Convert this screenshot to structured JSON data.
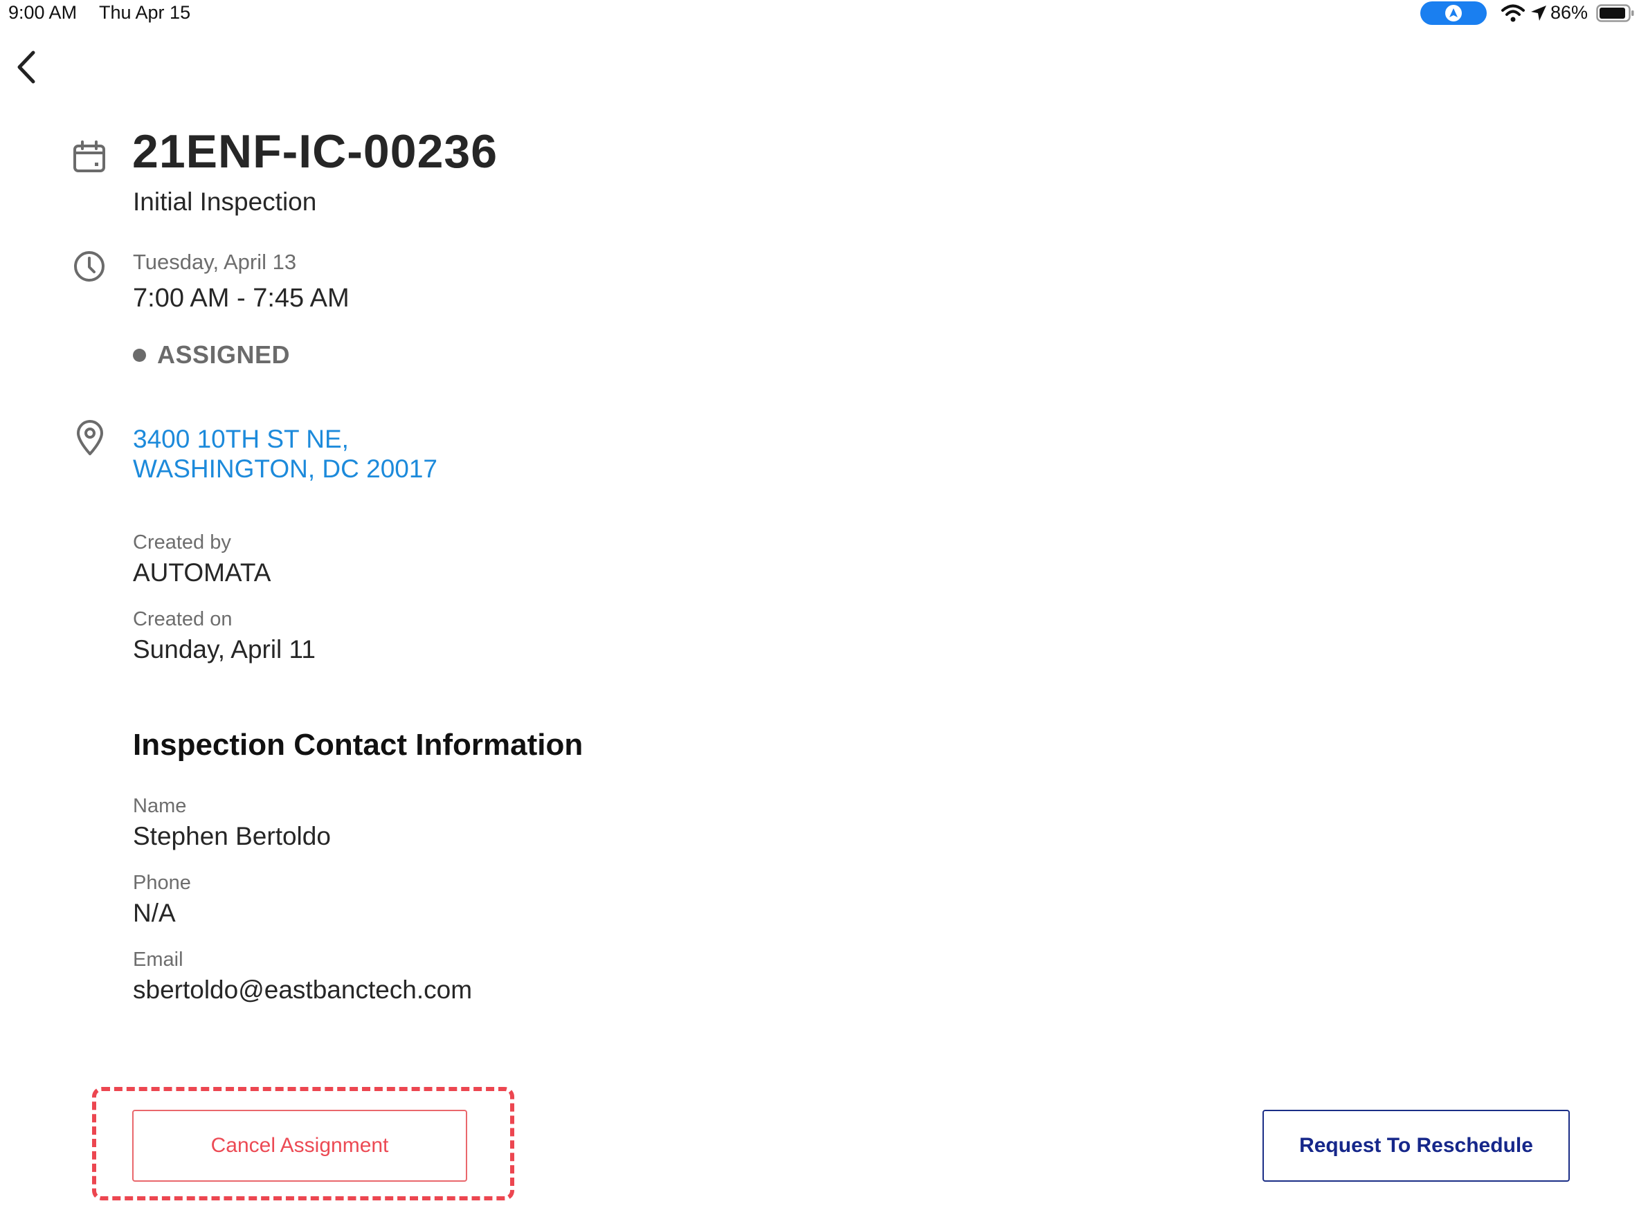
{
  "status_bar": {
    "time": "9:00 AM",
    "date": "Thu Apr 15",
    "battery": "86%",
    "nav_icon": "location-arrow-icon",
    "wifi_icon": "wifi-icon",
    "battery_icon": "battery-icon"
  },
  "header": {
    "back_icon": "chevron-left-icon"
  },
  "inspection": {
    "id": "21ENF-IC-00236",
    "type": "Initial Inspection",
    "date": "Tuesday, April 13",
    "time_range": "7:00 AM - 7:45 AM",
    "status": "ASSIGNED",
    "address_line1": "3400 10TH ST NE,",
    "address_line2": "WASHINGTON, DC 20017",
    "created_by_label": "Created by",
    "created_by": "AUTOMATA",
    "created_on_label": "Created on",
    "created_on": "Sunday, April 11"
  },
  "contact": {
    "section_title": "Inspection Contact Information",
    "name_label": "Name",
    "name": "Stephen Bertoldo",
    "phone_label": "Phone",
    "phone": "N/A",
    "email_label": "Email",
    "email": "sbertoldo@eastbanctech.com"
  },
  "actions": {
    "cancel_label": "Cancel Assignment",
    "reschedule_label": "Request To Reschedule"
  },
  "colors": {
    "link": "#1c8adb",
    "cancel": "#ec4a54",
    "reschedule": "#16278a",
    "status_gray": "#6b6b6b"
  }
}
